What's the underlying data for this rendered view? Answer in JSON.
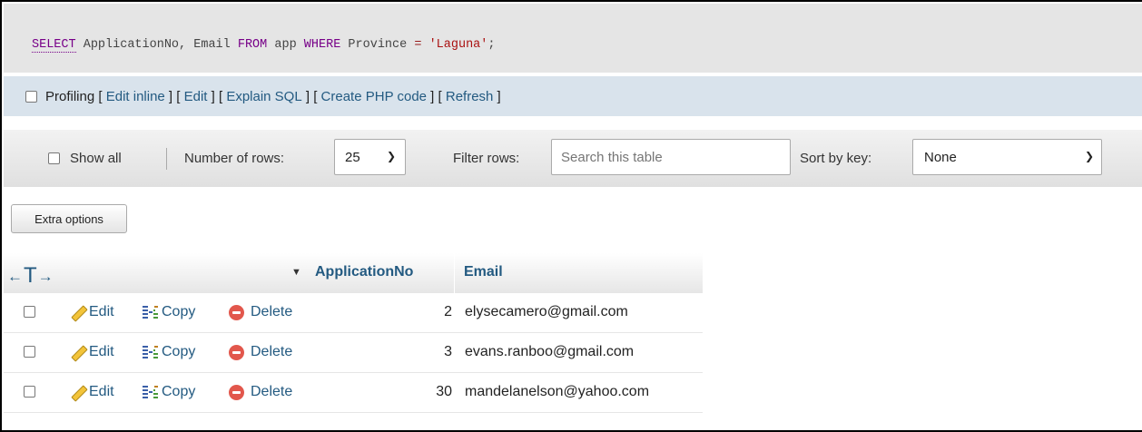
{
  "sql": {
    "kw_select": "SELECT",
    "columns": "ApplicationNo, Email",
    "kw_from": "FROM",
    "table": "app",
    "kw_where": "WHERE",
    "field": "Province",
    "operator": "=",
    "value": "'Laguna'",
    "terminator": ";"
  },
  "profiling": {
    "label": "Profiling",
    "links": [
      "Edit inline",
      "Edit",
      "Explain SQL",
      "Create PHP code",
      "Refresh"
    ]
  },
  "nav": {
    "show_all_label": "Show all",
    "rows_label": "Number of rows:",
    "rows_value": "25",
    "filter_label": "Filter rows:",
    "filter_placeholder": "Search this table",
    "sort_label": "Sort by key:",
    "sort_value": "None"
  },
  "extra_options_label": "Extra options",
  "table": {
    "arrow_left": "←",
    "arrow_t": "T",
    "arrow_right": "→",
    "sort_indicator": "▼",
    "columns": [
      "ApplicationNo",
      "Email"
    ],
    "actions": {
      "edit": "Edit",
      "copy": "Copy",
      "delete": "Delete"
    },
    "rows": [
      {
        "application_no": "2",
        "email": "elysecamero@gmail.com"
      },
      {
        "application_no": "3",
        "email": "evans.ranboo@gmail.com"
      },
      {
        "application_no": "30",
        "email": "mandelanelson@yahoo.com"
      }
    ]
  },
  "colors": {
    "link": "#235a81",
    "keyword": "#770088",
    "string": "#aa1111",
    "profiling_bg": "#d9e3ec",
    "sql_bg": "#e5e5e5",
    "delete_icon": "#e2574c",
    "edit_icon": "#f3c43a"
  },
  "icons": {
    "edit": "pencil-icon",
    "copy": "copy-row-icon",
    "delete": "delete-circle-icon",
    "sort": "triangle-down-icon",
    "dropdown": "chevron-down-icon"
  }
}
